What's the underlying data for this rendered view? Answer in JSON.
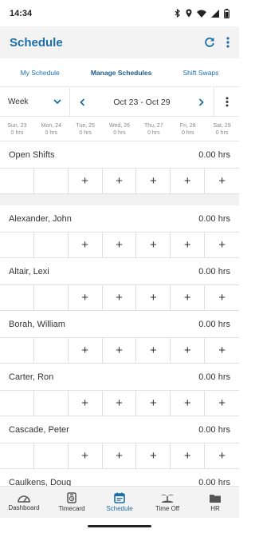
{
  "status_bar": {
    "time": "14:34",
    "icons": [
      "bluetooth-icon",
      "location-icon",
      "wifi-icon",
      "signal-icon",
      "battery-icon"
    ]
  },
  "header": {
    "title": "Schedule",
    "actions": [
      "refresh-icon",
      "more-vert-icon"
    ],
    "accent_color": "#1a6fa8"
  },
  "subnav": {
    "items": [
      {
        "label": "My Schedule",
        "active": false
      },
      {
        "label": "Manage Schedules",
        "active": true
      },
      {
        "label": "Shift Swaps",
        "active": false
      }
    ]
  },
  "week_bar": {
    "view_select": "Week",
    "date_range": "Oct 23 - Oct 29"
  },
  "days": [
    {
      "name": "Sun, 23",
      "hrs": "0 hrs"
    },
    {
      "name": "Mon, 24",
      "hrs": "0 hrs"
    },
    {
      "name": "Tue, 25",
      "hrs": "0 hrs"
    },
    {
      "name": "Wed, 26",
      "hrs": "0 hrs"
    },
    {
      "name": "Thu, 27",
      "hrs": "0 hrs"
    },
    {
      "name": "Fri, 28",
      "hrs": "0 hrs"
    },
    {
      "name": "Sat, 29",
      "hrs": "0 hrs"
    }
  ],
  "open_shifts": {
    "name": "Open Shifts",
    "hrs": "0.00 hrs"
  },
  "employees": [
    {
      "name": "Alexander, John",
      "hrs": "0.00 hrs"
    },
    {
      "name": "Altair, Lexi",
      "hrs": "0.00 hrs"
    },
    {
      "name": "Borah, William",
      "hrs": "0.00 hrs"
    },
    {
      "name": "Carter, Ron",
      "hrs": "0.00 hrs"
    },
    {
      "name": "Cascade, Peter",
      "hrs": "0.00 hrs"
    },
    {
      "name": "Caulkens, Doug",
      "hrs": "0.00 hrs"
    }
  ],
  "add_symbol": "+",
  "bottom_nav": {
    "items": [
      {
        "label": "Dashboard",
        "icon": "dashboard-icon",
        "active": false
      },
      {
        "label": "Timecard",
        "icon": "timecard-icon",
        "active": false
      },
      {
        "label": "Schedule",
        "icon": "schedule-icon",
        "active": true
      },
      {
        "label": "Time Off",
        "icon": "time-off-icon",
        "active": false
      },
      {
        "label": "HR",
        "icon": "hr-folder-icon",
        "active": false
      }
    ]
  }
}
